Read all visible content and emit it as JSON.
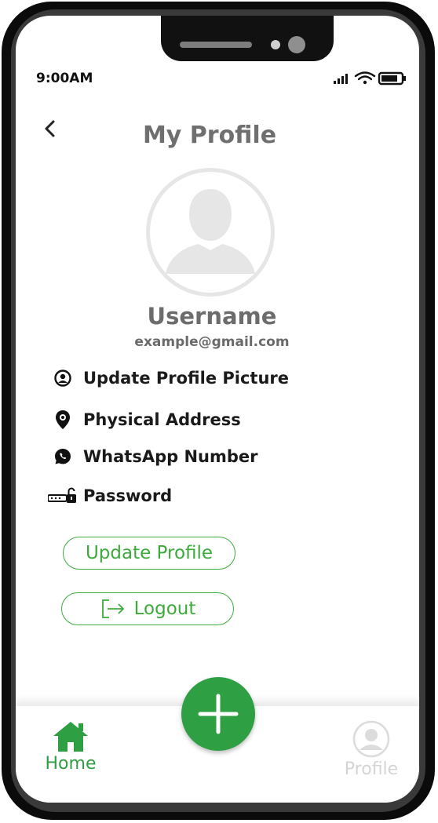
{
  "status_bar": {
    "time": "9:00AM"
  },
  "header": {
    "title": "My Profile"
  },
  "profile": {
    "username": "Username",
    "email": "example@gmail.com"
  },
  "menu": [
    {
      "label": "Update Profile Picture",
      "icon": "profile-picture-icon"
    },
    {
      "label": "Physical Address",
      "icon": "location-pin-icon"
    },
    {
      "label": "WhatsApp Number",
      "icon": "whatsapp-icon"
    },
    {
      "label": "Password",
      "icon": "password-lock-icon"
    }
  ],
  "actions": {
    "update_profile": "Update Profile",
    "logout": "Logout"
  },
  "bottom_nav": {
    "home": "Home",
    "profile": "Profile"
  },
  "colors": {
    "accent": "#2ea043",
    "title_gray": "#6f6f6f",
    "inactive": "#d4d4d4"
  }
}
